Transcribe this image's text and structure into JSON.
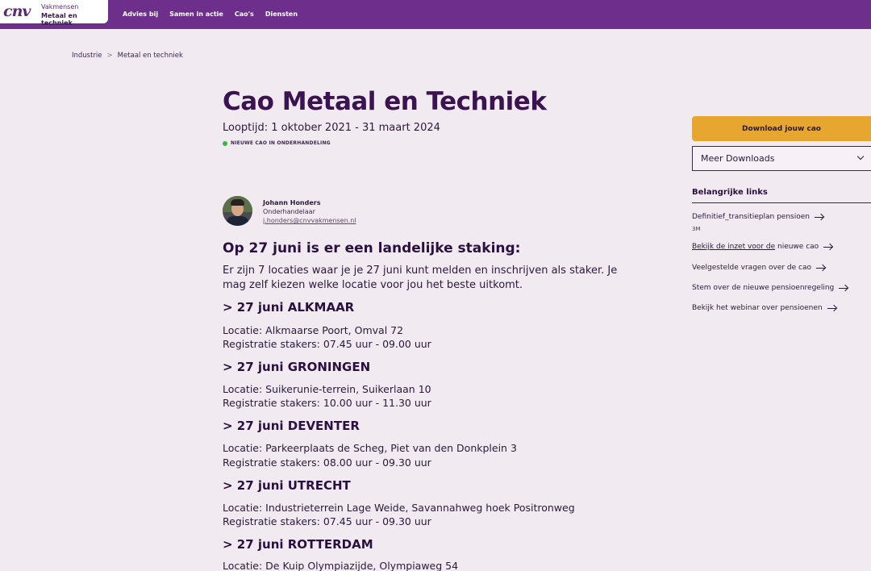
{
  "brand": {
    "mark": "cnv",
    "line1": "Vakmensen",
    "line2": "Metaal en techniek"
  },
  "nav": [
    "Advies bij",
    "Samen in actie",
    "Cao's",
    "Diensten"
  ],
  "breadcrumb": {
    "items": [
      "Industrie",
      "Metaal en techniek"
    ],
    "separator": ">"
  },
  "page": {
    "title": "Cao Metaal en Techniek",
    "looptijd": "Looptijd: 1 oktober 2021 - 31 maart 2024",
    "status": "NIEUWE CAO IN ONDERHANDELING",
    "status_color": "#3ab44a"
  },
  "contact": {
    "name": "Johann Honders",
    "role": "Onderhandelaar",
    "email": "j.honders@cnvvakmensen.nl"
  },
  "article": {
    "heading": "Op 27 juni is er een landelijke staking:",
    "intro": "Er zijn 7 locaties waar je je 27 juni kunt melden en inschrijven als staker. Je mag zelf kiezen welke locatie voor jou het beste uitkomt.",
    "locations": [
      {
        "heading": "> 27 juni ALKMAAR",
        "locatie": "Locatie: Alkmaarse Poort, Omval 72",
        "registratie": "Registratie stakers: 07.45 uur - 09.00 uur"
      },
      {
        "heading": "> 27 juni GRONINGEN",
        "locatie": "Locatie: Suikerunie-terrein, Suikerlaan 10",
        "registratie": "Registratie stakers: 10.00 uur - 11.30 uur"
      },
      {
        "heading": "> 27 juni DEVENTER",
        "locatie": "Locatie: Parkeerplaats de Scheg, Piet van den Donkplein 3",
        "registratie": "Registratie stakers: 08.00 uur - 09.30 uur"
      },
      {
        "heading": "> 27 juni UTRECHT",
        "locatie": "Locatie: Industrieterrein Lage Weide, Savannahweg hoek Positronweg",
        "registratie": "Registratie stakers: 07.45 uur - 09.30 uur"
      },
      {
        "heading": "> 27 juni ROTTERDAM",
        "locatie": "Locatie: De Kuip Olympiazijde, Olympiaweg 54",
        "registratie": ""
      }
    ]
  },
  "sidebar": {
    "download_button": "Download jouw cao",
    "download_color": "#e6a630",
    "dropdown_label": "Meer Downloads",
    "links_title": "Belangrijke links",
    "link_meta": "3M",
    "links": [
      {
        "pre": "Definitief_transitieplan pensioen",
        "underlined": ""
      },
      {
        "pre": "",
        "underlined": "Bekijk de inzet voor de",
        "post": " nieuwe cao"
      },
      {
        "pre": "Veelgestelde vragen over de cao",
        "underlined": ""
      },
      {
        "pre": "Stem over de nieuwe pensioenregeling",
        "underlined": ""
      },
      {
        "pre": "Bekijk het webinar over pensioenen",
        "underlined": ""
      }
    ]
  },
  "colors": {
    "nav_bg": "#6e2f8c",
    "page_bg": "#f2eaf1",
    "title": "#3a1350"
  }
}
